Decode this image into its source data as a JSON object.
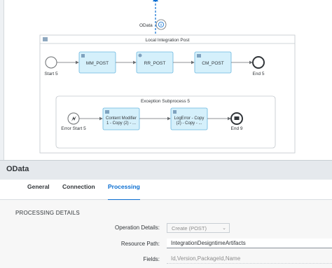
{
  "diagram": {
    "sender_label": "OData",
    "pool_label": "Local Integration Post",
    "main_flow": {
      "start": "Start 5",
      "steps": [
        "MM_POST",
        "RR_POST",
        "CM_POST"
      ],
      "end": "End 5"
    },
    "exception_subprocess": {
      "title": "Exception Subprocess 5",
      "error_start": "Error Start 5",
      "step1_lines": [
        "Content Modifier",
        "1 - Copy (2) - ..."
      ],
      "step2_lines": [
        "LogError - Copy",
        "(2) - Copy - ..."
      ],
      "end": "End 9"
    }
  },
  "panel": {
    "title": "OData",
    "tabs": [
      {
        "label": "General",
        "active": false
      },
      {
        "label": "Connection",
        "active": false
      },
      {
        "label": "Processing",
        "active": true
      }
    ],
    "section_title": "PROCESSING DETAILS",
    "fields": {
      "operation": {
        "label": "Operation Details:",
        "value": "Create (POST)"
      },
      "resource_path": {
        "label": "Resource Path:",
        "value": "IntegrationDesigntimeArtifacts"
      },
      "fields": {
        "label": "Fields:",
        "placeholder": "Id,Version,PackageId,Name"
      }
    }
  },
  "colors": {
    "accent": "#0a6ed1",
    "task_fill": "#d5f0fb",
    "task_border": "#6ab7e0"
  }
}
